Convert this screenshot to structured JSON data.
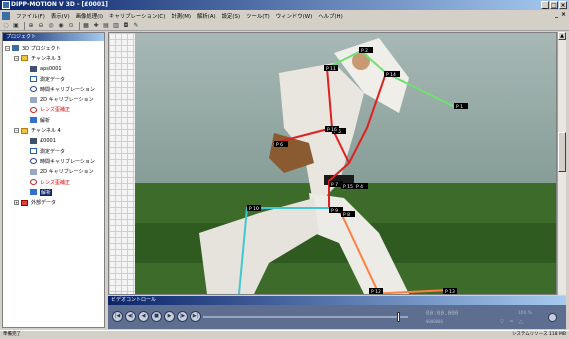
{
  "window": {
    "title": "DIPP-MOTION V 3D - [£0001]",
    "buttons": [
      "_",
      "□",
      "×"
    ]
  },
  "menu": {
    "items": [
      "ファイル(F)",
      "表示(V)",
      "画像処理(I)",
      "キャリブレーション(C)",
      "計測(M)",
      "解析(A)",
      "設定(S)",
      "ツール(T)",
      "ウィンドウ(W)",
      "ヘルプ(H)"
    ],
    "mdi_buttons": [
      "_",
      "×"
    ]
  },
  "project": {
    "header": "プロジェクト",
    "nodes": [
      {
        "label": "3D プロジェクト",
        "icon": "doc",
        "level": 0,
        "exp": "−"
      },
      {
        "label": "チャンネル 3",
        "icon": "folder",
        "level": 1,
        "exp": "−"
      },
      {
        "label": "aps0001",
        "icon": "video",
        "level": 2
      },
      {
        "label": "測定データ",
        "icon": "graph",
        "level": 2
      },
      {
        "label": "時間キャリブレーション",
        "icon": "clock",
        "level": 2
      },
      {
        "label": "2D キャリブレーション",
        "icon": "calib",
        "level": 2
      },
      {
        "label": "レンズ歪補正",
        "icon": "lens",
        "level": 2,
        "red": true
      },
      {
        "label": "解析",
        "icon": "chart",
        "level": 2
      },
      {
        "label": "チャンネル 4",
        "icon": "folder",
        "level": 1,
        "exp": "−"
      },
      {
        "label": "£0001",
        "icon": "video",
        "level": 2
      },
      {
        "label": "測定データ",
        "icon": "graph",
        "level": 2
      },
      {
        "label": "時間キャリブレーション",
        "icon": "clock",
        "level": 2
      },
      {
        "label": "2D キャリブレーション",
        "icon": "calib",
        "level": 2
      },
      {
        "label": "レンズ歪補正",
        "icon": "lens",
        "level": 2,
        "red": true
      },
      {
        "label": "解析",
        "icon": "chart",
        "level": 2,
        "selected": true
      },
      {
        "label": "外部データ",
        "icon": "ext",
        "level": 1,
        "exp": "+"
      }
    ]
  },
  "viewer": {
    "markers": [
      "P 1",
      "P 2",
      "P 3",
      "P 4",
      "P 5",
      "P 6",
      "P 7",
      "P 8",
      "P 9",
      "P 10",
      "P 11",
      "P 12",
      "P 13",
      "P 14",
      "P 15",
      "P 16"
    ],
    "colors": {
      "torso": "#e02020",
      "arm": "#70e070",
      "leg_front": "#40c8d0",
      "leg_back": "#ff8040",
      "field": "#3d6b2a",
      "sky": "#8fa8a8"
    }
  },
  "video_control": {
    "header": "ビデオコントロール",
    "buttons": [
      "|◀",
      "◀|",
      "◀",
      "■",
      "▶",
      "|▶",
      "▶|"
    ],
    "position": 0.97,
    "timecode": "00:00.000",
    "frame": "0000000",
    "speed": "100 %",
    "icons": [
      "▽",
      "═",
      "△"
    ]
  },
  "status": {
    "left": "準備完了",
    "right": "システムリソース 118 MB"
  }
}
